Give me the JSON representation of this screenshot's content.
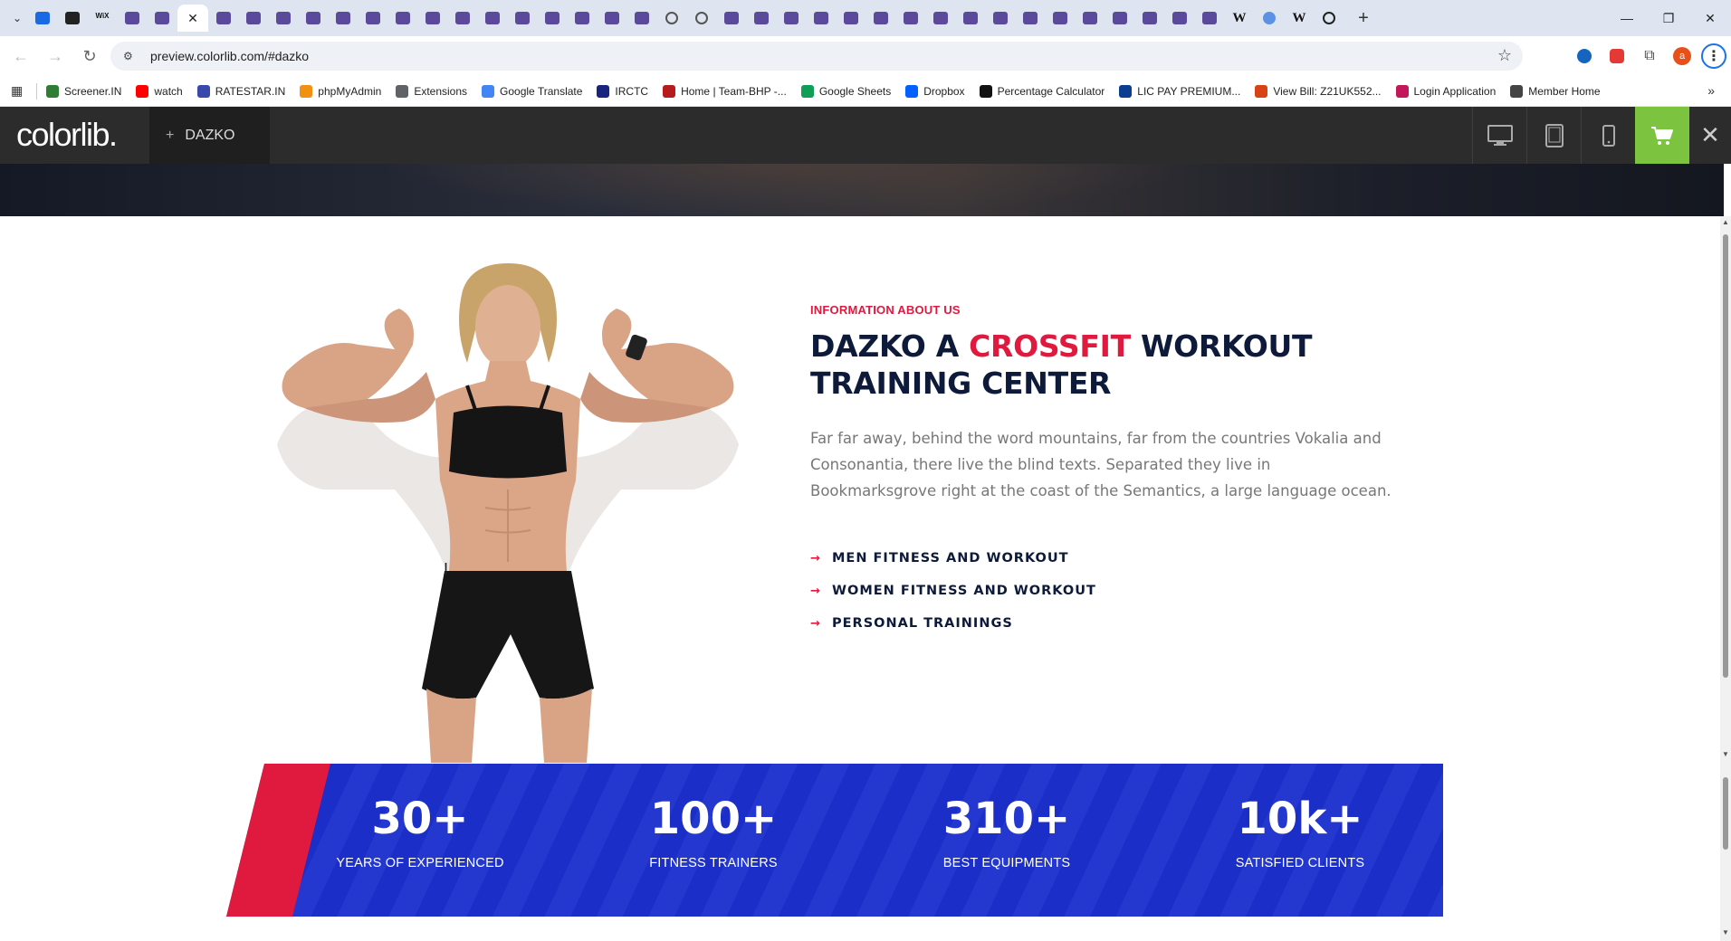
{
  "browser": {
    "url": "preview.colorlib.com/#dazko",
    "bookmarks": [
      {
        "label": "Screener.IN",
        "color": "#2e7d32"
      },
      {
        "label": "watch",
        "color": "#ff0000"
      },
      {
        "label": "RATESTAR.IN",
        "color": "#3949ab"
      },
      {
        "label": "phpMyAdmin",
        "color": "#f29111"
      },
      {
        "label": "Extensions",
        "color": "#5f6368"
      },
      {
        "label": "Google Translate",
        "color": "#4285f4"
      },
      {
        "label": "IRCTC",
        "color": "#1a237e"
      },
      {
        "label": "Home | Team-BHP -...",
        "color": "#b71c1c"
      },
      {
        "label": "Google Sheets",
        "color": "#0f9d58"
      },
      {
        "label": "Dropbox",
        "color": "#0061ff"
      },
      {
        "label": "Percentage Calculator",
        "color": "#111111"
      },
      {
        "label": "LIC PAY PREMIUM...",
        "color": "#0b3d91"
      },
      {
        "label": "View Bill: Z21UK552...",
        "color": "#d84315"
      },
      {
        "label": "Login Application",
        "color": "#c2185b"
      },
      {
        "label": "Member Home",
        "color": "#444444"
      }
    ],
    "profile_initial": "a"
  },
  "colorlib": {
    "logo": "colorlib.",
    "theme_plus": "+",
    "theme_name": "DAZKO",
    "close_glyph": "✕"
  },
  "about": {
    "eyebrow": "INFORMATION ABOUT US",
    "heading_part1": "DAZKO A ",
    "heading_accent": "CROSSFIT",
    "heading_part2": " WORKOUT TRAINING CENTER",
    "description": "Far far away, behind the word mountains, far from the countries Vokalia and Consonantia, there live the blind texts. Separated they live in Bookmarksgrove right at the coast of the Semantics, a large language ocean.",
    "features": [
      "MEN FITNESS AND WORKOUT",
      "WOMEN FITNESS AND WORKOUT",
      "PERSONAL TRAININGS"
    ]
  },
  "stats": [
    {
      "number": "30+",
      "label": "YEARS OF EXPERIENCED"
    },
    {
      "number": "100+",
      "label": "FITNESS TRAINERS"
    },
    {
      "number": "310+",
      "label": "BEST EQUIPMENTS"
    },
    {
      "number": "10k+",
      "label": "SATISFIED CLIENTS"
    }
  ],
  "colors": {
    "accent_red": "#e0193f",
    "navy": "#0d1a3a",
    "stats_blue": "#1b2ec7",
    "cart_green": "#7cc340"
  }
}
